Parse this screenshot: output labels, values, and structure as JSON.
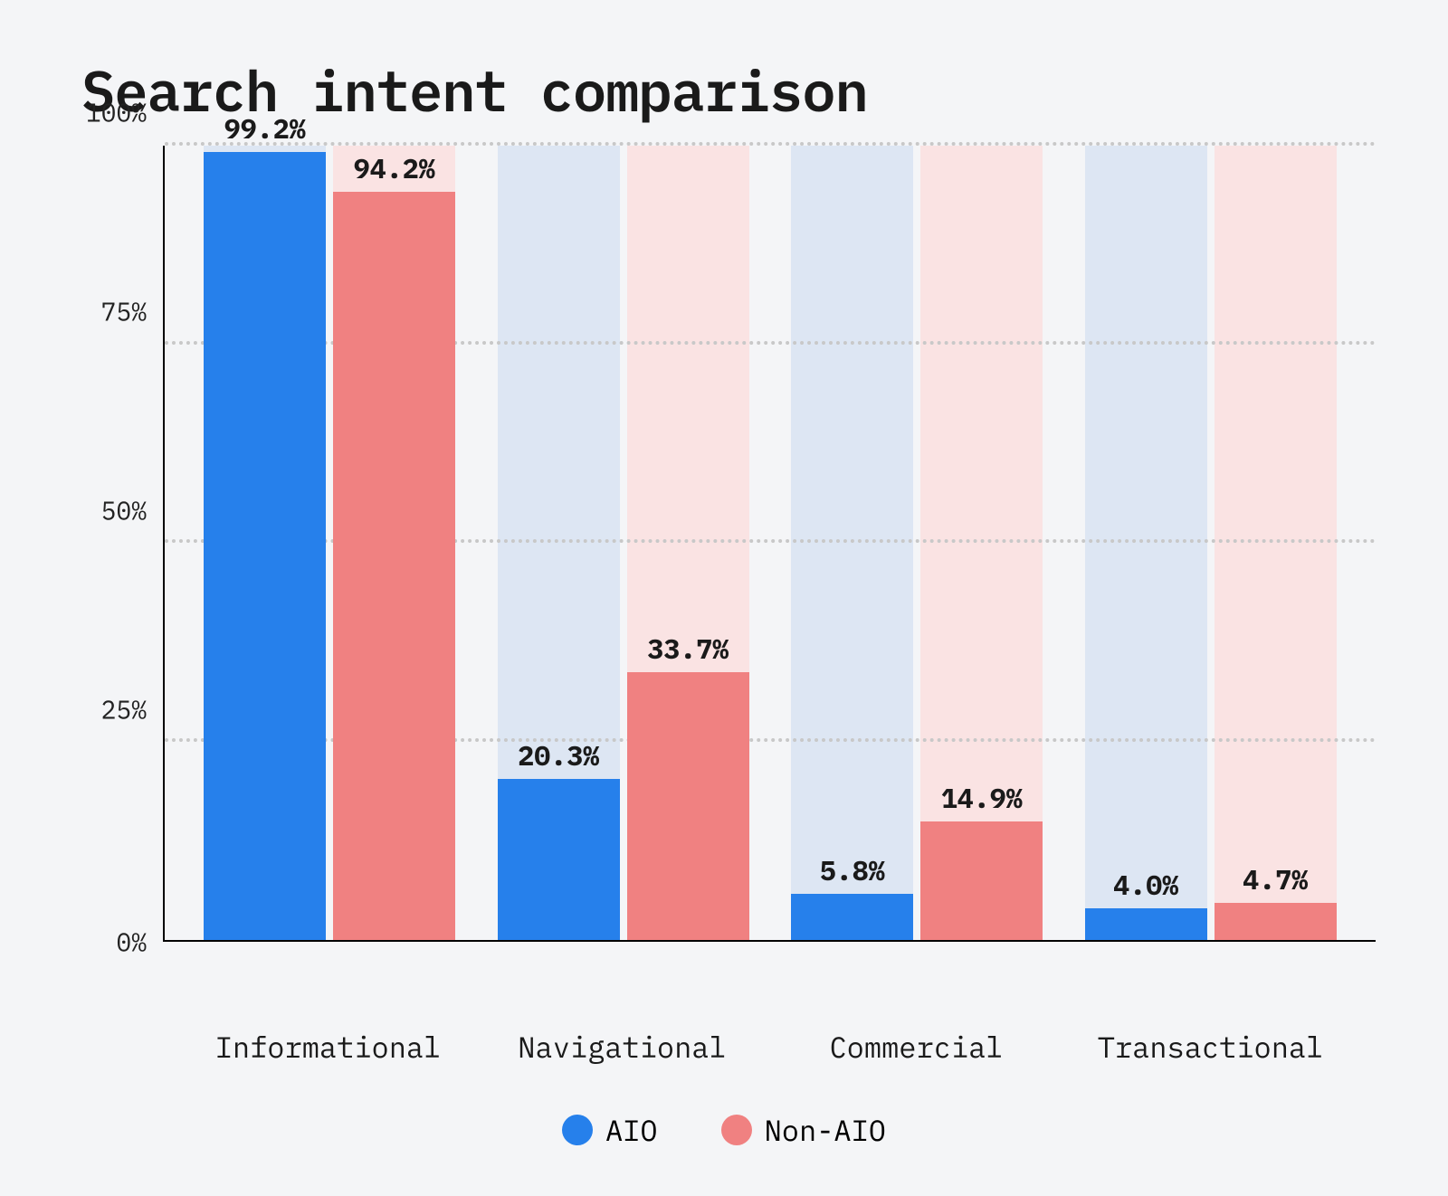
{
  "chart_data": {
    "type": "bar",
    "title": "Search intent comparison",
    "categories": [
      "Informational",
      "Navigational",
      "Commercial",
      "Transactional"
    ],
    "series": [
      {
        "name": "AIO",
        "values": [
          99.2,
          20.3,
          5.8,
          4.0
        ],
        "color": "#2680eb",
        "bgcolor": "#dde6f3"
      },
      {
        "name": "Non-AIO",
        "values": [
          94.2,
          33.7,
          14.9,
          4.7
        ],
        "color": "#f08181",
        "bgcolor": "#fae3e3"
      }
    ],
    "ylabel": "",
    "xlabel": "",
    "ylim": [
      0,
      100
    ],
    "yticks": [
      0,
      25,
      50,
      75,
      100
    ],
    "grid": true,
    "legend_position": "bottom",
    "value_labels": [
      [
        "99.2%",
        "94.2%"
      ],
      [
        "20.3%",
        "33.7%"
      ],
      [
        "5.8%",
        "14.9%"
      ],
      [
        "4.0%",
        "4.7%"
      ]
    ],
    "ytick_labels": [
      "0%",
      "25%",
      "50%",
      "75%",
      "100%"
    ]
  }
}
